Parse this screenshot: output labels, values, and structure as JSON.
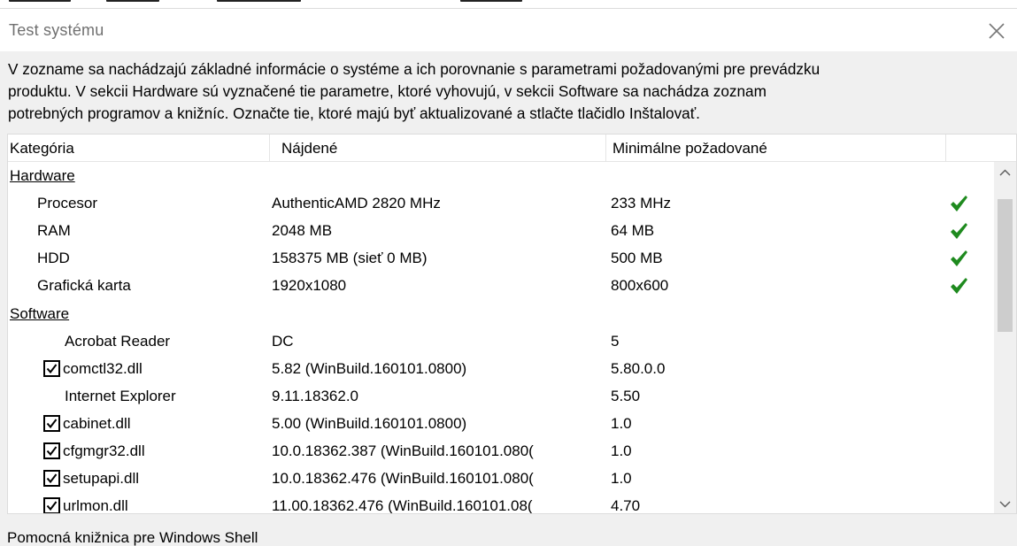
{
  "dialog": {
    "title": "Test systému",
    "description_lines": [
      "V zozname sa nachádzajú základné informácie o systéme a ich porovnanie s parametrami požadovanými pre prevádzku",
      "produktu. V sekcii Hardware sú vyznačené tie parametre, ktoré vyhovujú, v sekcii Software sa nachádza zoznam",
      "potrebných programov a knižníc. Označte tie, ktoré majú byť aktualizované a stlačte tlačidlo Inštalovať."
    ]
  },
  "table": {
    "columns": [
      "Kategória",
      "Nájdené",
      "Minimálne požadované"
    ],
    "groups": {
      "hardware": "Hardware",
      "software": "Software"
    },
    "hardware_rows": [
      {
        "name": "Procesor",
        "found": "AuthenticAMD 2820 MHz",
        "required": "233 MHz",
        "ok": true
      },
      {
        "name": "RAM",
        "found": "2048 MB",
        "required": "64 MB",
        "ok": true
      },
      {
        "name": "HDD",
        "found": "158375 MB (sieť 0 MB)",
        "required": "500 MB",
        "ok": true
      },
      {
        "name": "Grafická karta",
        "found": "1920x1080",
        "required": "800x600",
        "ok": true
      }
    ],
    "software_rows": [
      {
        "name": "Acrobat Reader",
        "found": "DC",
        "required": "5",
        "checkbox": false
      },
      {
        "name": "comctl32.dll",
        "found": "5.82 (WinBuild.160101.0800)",
        "required": "5.80.0.0",
        "checkbox": true,
        "checked": true
      },
      {
        "name": "Internet Explorer",
        "found": "9.11.18362.0",
        "required": "5.50",
        "checkbox": false
      },
      {
        "name": "cabinet.dll",
        "found": "5.00 (WinBuild.160101.0800)",
        "required": "1.0",
        "checkbox": true,
        "checked": true
      },
      {
        "name": "cfgmgr32.dll",
        "found": "10.0.18362.387 (WinBuild.160101.080(",
        "required": "1.0",
        "checkbox": true,
        "checked": true
      },
      {
        "name": "setupapi.dll",
        "found": "10.0.18362.476 (WinBuild.160101.080(",
        "required": "1.0",
        "checkbox": true,
        "checked": true
      },
      {
        "name": "urlmon.dll",
        "found": "11.00.18362.476 (WinBuild.160101.08(",
        "required": "4.70",
        "checkbox": true,
        "checked": true
      }
    ]
  },
  "status_text": "Pomocná knižnica pre Windows Shell",
  "colors": {
    "check_green": "#1e8a1e",
    "panel_bg": "#f0f0f0",
    "scroll_thumb": "#cdcdcd"
  },
  "icons": {
    "close": "close-icon",
    "ok": "green-check-icon",
    "scroll_up": "chevron-up-icon",
    "scroll_down": "chevron-down-icon"
  }
}
